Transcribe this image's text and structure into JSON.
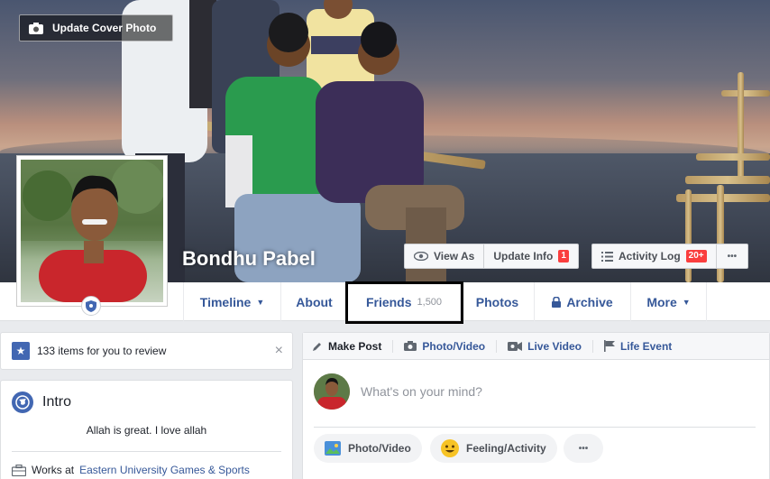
{
  "cover": {
    "update_cover_label": "Update Cover Photo"
  },
  "profile": {
    "name": "Bondhu Pabel"
  },
  "actions": {
    "view_as": "View As",
    "update_info": "Update Info",
    "update_info_badge": "1",
    "activity_log": "Activity Log",
    "activity_log_badge": "20+",
    "more_dots": "•••"
  },
  "nav": {
    "timeline": "Timeline",
    "about": "About",
    "friends": "Friends",
    "friends_count": "1,500",
    "photos": "Photos",
    "archive": "Archive",
    "more": "More"
  },
  "review": {
    "text": "133 items for you to review",
    "close": "×"
  },
  "intro": {
    "title": "Intro",
    "bio": "Allah is great. I love allah",
    "works_prefix": "Works at",
    "works_link": "Eastern University Games & Sports"
  },
  "composer": {
    "tabs": [
      "Make Post",
      "Photo/Video",
      "Live Video",
      "Life Event"
    ],
    "placeholder": "What's on your mind?",
    "photo_video": "Photo/Video",
    "feeling": "Feeling/Activity",
    "more": "•••"
  },
  "colors": {
    "link": "#365899",
    "badge": "#fa3e3e",
    "brand": "#4267b2"
  }
}
